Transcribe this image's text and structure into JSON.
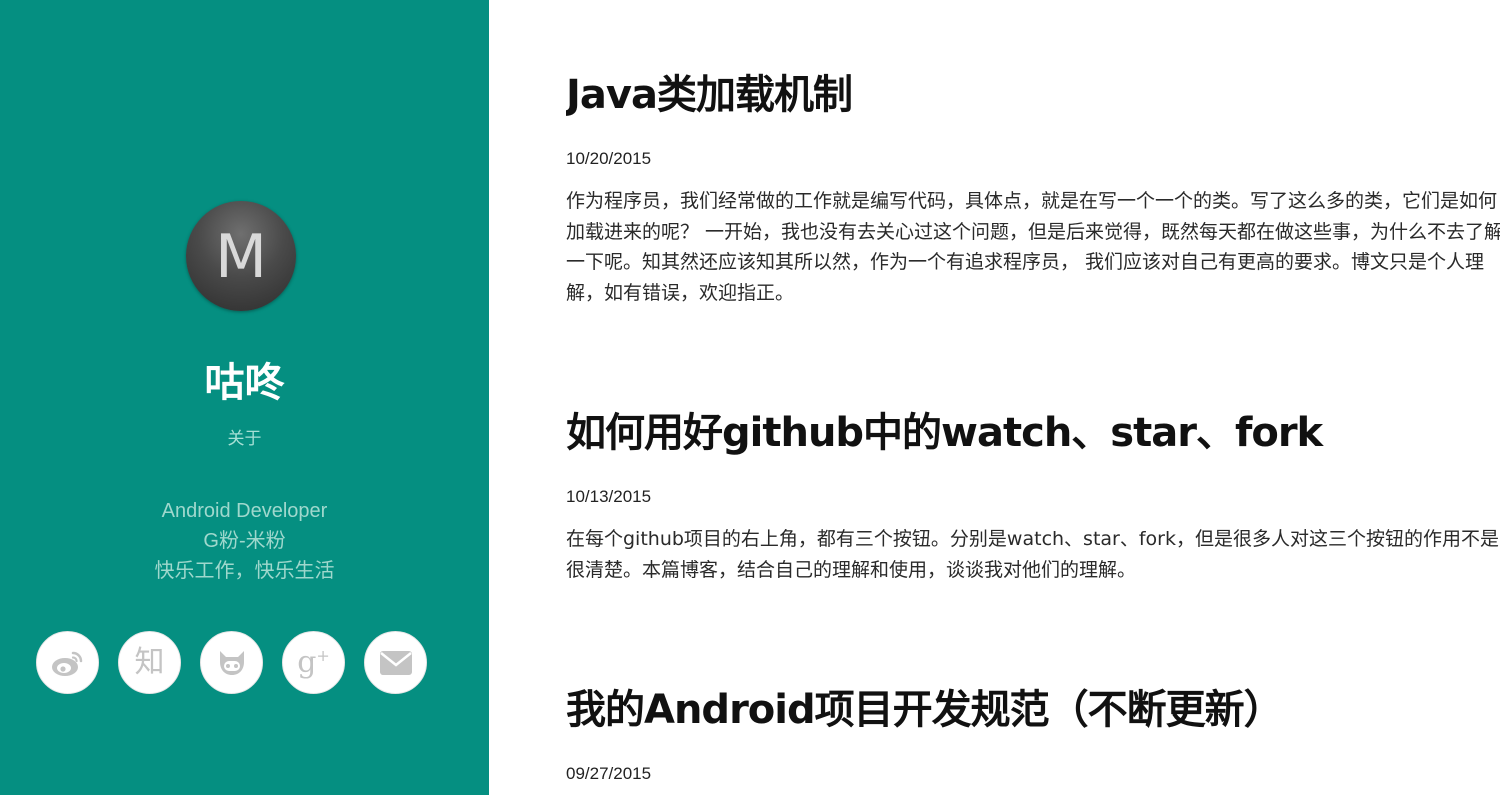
{
  "sidebar": {
    "avatar_letter": "M",
    "author_name": "咕咚",
    "about_label": "关于",
    "bio_lines": [
      "Android Developer",
      "G粉-米粉",
      "快乐工作，快乐生活"
    ],
    "social_links": [
      {
        "icon": "weibo-icon"
      },
      {
        "icon": "zhihu-icon",
        "glyph": "知"
      },
      {
        "icon": "github-icon"
      },
      {
        "icon": "google-plus-icon",
        "glyph": "g",
        "sup": "+"
      },
      {
        "icon": "mail-icon"
      }
    ],
    "bg_color": "#058F81"
  },
  "posts": [
    {
      "title": "Java类加载机制",
      "date": "10/20/2015",
      "excerpt": "作为程序员，我们经常做的工作就是编写代码，具体点，就是在写一个一个的类。写了这么多的类，它们是如何加载进来的呢？ 一开始，我也没有去关心过这个问题，但是后来觉得，既然每天都在做这些事，为什么不去了解一下呢。知其然还应该知其所以然，作为一个有追求程序员， 我们应该对自己有更高的要求。博文只是个人理解，如有错误，欢迎指正。"
    },
    {
      "title": "如何用好github中的watch、star、fork",
      "date": "10/13/2015",
      "excerpt": "在每个github项目的右上角，都有三个按钮。分别是watch、star、fork，但是很多人对这三个按钮的作用不是很清楚。本篇博客，结合自己的理解和使用，谈谈我对他们的理解。"
    },
    {
      "title": "我的Android项目开发规范（不断更新）",
      "date": "09/27/2015"
    }
  ]
}
